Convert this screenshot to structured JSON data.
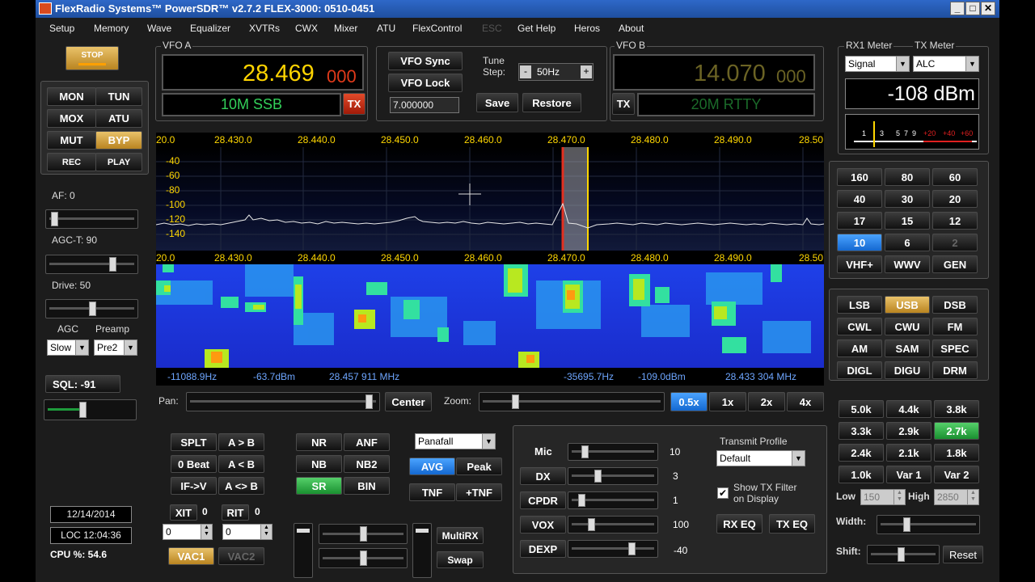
{
  "app": {
    "title": "FlexRadio Systems™ PowerSDR™ v2.7.2   FLEX-3000: 0510-0451"
  },
  "window_buttons": {
    "min": "_",
    "max": "□",
    "close": "✕"
  },
  "menu": [
    "Setup",
    "Memory",
    "Wave",
    "Equalizer",
    "XVTRs",
    "CWX",
    "Mixer",
    "ATU",
    "FlexControl",
    "ESC",
    "Get Help",
    "Heros",
    "About"
  ],
  "left": {
    "stop": "STOP",
    "mon": "MON",
    "tun": "TUN",
    "mox": "MOX",
    "atu": "ATU",
    "mut": "MUT",
    "byp": "BYP",
    "rec": "REC",
    "play": "PLAY",
    "af": "AF:  0",
    "agct": "AGC-T:  90",
    "drive": "Drive:  50",
    "agc": "AGC",
    "preamp": "Preamp",
    "agc_val": "Slow",
    "preamp_val": "Pre2",
    "sql": "SQL:  -91",
    "date": "12/14/2014",
    "time": "LOC 12:04:36",
    "cpu": "CPU %:  54.6"
  },
  "vfoa": {
    "label": "VFO A",
    "freq_main": "28.469",
    "freq_sub": "000",
    "band_mode": "10M SSB",
    "tx": "TX"
  },
  "vfob": {
    "label": "VFO B",
    "freq_main": "14.070",
    "freq_sub": "000",
    "band_mode": "20M RTTY",
    "tx": "TX"
  },
  "center": {
    "vfo_sync": "VFO Sync",
    "vfo_lock": "VFO Lock",
    "tune_step_label": "Tune Step:",
    "tune_step": "50Hz",
    "minus": "-",
    "plus": "+",
    "freq_input": "7.000000",
    "save": "Save",
    "restore": "Restore"
  },
  "meter": {
    "group": "RX1 Meter",
    "tx_group": "TX Meter",
    "rx_sel": "Signal",
    "tx_sel": "ALC",
    "reading": "-108 dBm",
    "scale": [
      "1",
      "3",
      "5",
      "7",
      "9",
      "+20",
      "+40",
      "+60"
    ]
  },
  "panadapter": {
    "freq_ticks": [
      "20.0",
      "28.430.0",
      "28.440.0",
      "28.450.0",
      "28.460.0",
      "28.470.0",
      "28.480.0",
      "28.490.0",
      "28.50"
    ],
    "db_ticks": [
      "-40",
      "-60",
      "-80",
      "-100",
      "-120",
      "-140"
    ],
    "info_left": [
      "-11088.9Hz",
      "-63.7dBm",
      "28.457 911 MHz"
    ],
    "info_right": [
      "-35695.7Hz",
      "-109.0dBm",
      "28.433 304 MHz"
    ]
  },
  "pan": {
    "pan_label": "Pan:",
    "center": "Center",
    "zoom_label": "Zoom:",
    "zoom": [
      "0.5x",
      "1x",
      "2x",
      "4x"
    ]
  },
  "bands": [
    "160",
    "80",
    "60",
    "40",
    "30",
    "20",
    "17",
    "15",
    "12",
    "10",
    "6",
    "2",
    "VHF+",
    "WWV",
    "GEN"
  ],
  "modes": [
    "LSB",
    "USB",
    "DSB",
    "CWL",
    "CWU",
    "FM",
    "AM",
    "SAM",
    "SPEC",
    "DIGL",
    "DIGU",
    "DRM"
  ],
  "filters": [
    "5.0k",
    "4.4k",
    "3.8k",
    "3.3k",
    "2.9k",
    "2.7k",
    "2.4k",
    "2.1k",
    "1.8k",
    "1.0k",
    "Var 1",
    "Var 2"
  ],
  "filter_ctrl": {
    "low": "Low",
    "low_val": "150",
    "high": "High",
    "high_val": "2850",
    "width": "Width:",
    "shift": "Shift:",
    "reset": "Reset"
  },
  "bottom_left": {
    "splt": "SPLT",
    "atob": "A > B",
    "zerobeat": "0 Beat",
    "alessb": "A < B",
    "ifv": "IF->V",
    "aswap": "A <> B",
    "xit": "XIT",
    "xit_v": "0",
    "rit": "RIT",
    "rit_v": "0",
    "xit_field": "0",
    "rit_field": "0",
    "vac1": "VAC1",
    "vac2": "VAC2"
  },
  "dsp": {
    "nr": "NR",
    "anf": "ANF",
    "nb": "NB",
    "nb2": "NB2",
    "sr": "SR",
    "bin": "BIN",
    "display_mode": "Panafall",
    "avg": "AVG",
    "peak": "Peak",
    "tnf": "TNF",
    "ptnf": "+TNF",
    "multirx": "MultiRX",
    "swap": "Swap"
  },
  "tx": {
    "mic": "Mic",
    "mic_v": "10",
    "dx": "DX",
    "dx_v": "3",
    "cpdr": "CPDR",
    "cpdr_v": "1",
    "vox": "VOX",
    "vox_v": "100",
    "dexp": "DEXP",
    "dexp_v": "-40",
    "profile_label": "Transmit Profile",
    "profile": "Default",
    "show_filter": "Show TX Filter on Display",
    "rxeq": "RX EQ",
    "txeq": "TX EQ"
  },
  "colors": {
    "vfo_a_freq": "#ffd400",
    "vfo_sub": "#e03a1a",
    "vfo_b_freq": "#6b6324",
    "band_text": "#33d15a",
    "meter_needle": "#ffd700",
    "accent_orange": "#f0a020"
  }
}
